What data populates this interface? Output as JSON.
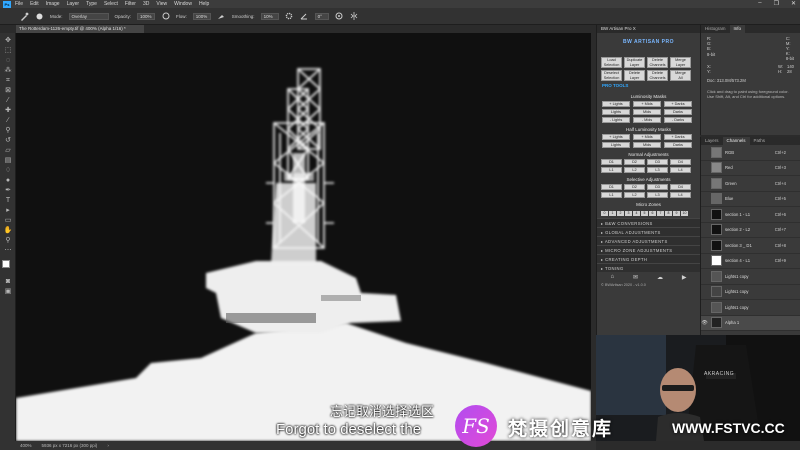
{
  "menubar": {
    "logo": "Ps",
    "items": [
      "File",
      "Edit",
      "Image",
      "Layer",
      "Type",
      "Select",
      "Filter",
      "3D",
      "View",
      "Window",
      "Help"
    ],
    "window_controls": [
      "–",
      "❐",
      "✕"
    ]
  },
  "options": {
    "mode_label": "Mode:",
    "mode_value": "Overlay",
    "opacity_label": "Opacity:",
    "opacity_value": "100%",
    "flow_label": "Flow:",
    "flow_value": "100%",
    "smoothing_label": "Smoothing:",
    "smoothing_value": "10%",
    "angle_value": "0°"
  },
  "document": {
    "tab_title": "The Rotterdam-1126-empty.tif @ 400% (Alpha 1/16) *"
  },
  "status": {
    "zoom": "400%",
    "dimensions": "5936 px x 7216 px (300 ppi)"
  },
  "plugin": {
    "title": "BW Artisan Pro X",
    "logo": "BW ARTISAN PRO",
    "top_buttons": [
      [
        "Load",
        "Selection"
      ],
      [
        "Duplicate",
        "Layer"
      ],
      [
        "Delete",
        "Channels"
      ],
      [
        "Merge",
        "Layer"
      ],
      [
        "Deselect",
        "Selection"
      ],
      [
        "Delete",
        "Layer"
      ],
      [
        "Delete",
        "Channels"
      ],
      [
        "Merge",
        "All"
      ]
    ],
    "pro_tools": "PRO TOOLS",
    "luminosity_title": "Luminosity Masks",
    "lum_row1": [
      "+ Lights",
      "+ Mids",
      "+ Darks"
    ],
    "lum_row2": [
      "Lights",
      "Mids",
      "Darks"
    ],
    "lum_row3": [
      "- Lights",
      "- Mids",
      "- Darks"
    ],
    "half_title": "Half Luminosity Masks",
    "half_row1": [
      "+ Lights",
      "+ Mids",
      "+ Darks"
    ],
    "half_row2": [
      "Lights",
      "Mids",
      "Darks"
    ],
    "normal_title": "Normal Adjustments",
    "normal_row1": [
      "D1",
      "D2",
      "D3",
      "D4"
    ],
    "normal_row2": [
      "L1",
      "L2",
      "L3",
      "L4"
    ],
    "selective_title": "Selective Adjustments",
    "selective_row1": [
      "D1",
      "D2",
      "D3",
      "D4"
    ],
    "selective_row2": [
      "L1",
      "L2",
      "L3",
      "L4"
    ],
    "micro_title": "Micro Zones",
    "zones": [
      "0",
      "1",
      "2",
      "3",
      "4",
      "5",
      "6",
      "7",
      "8",
      "9",
      "10"
    ],
    "sections": [
      "B&W CONVERSIONS",
      "GLOBAL ADJUSTMENTS",
      "ADVANCED ADJUSTMENTS",
      "MICRO ZONE ADJUSTMENTS",
      "CREATING DEPTH",
      "TONING"
    ],
    "footer": "© BWArtisan 2020 - v1.0.0"
  },
  "histo_panel": {
    "tabs": [
      "Histogram",
      "Info"
    ],
    "rgb_labels": [
      "R:",
      "G:",
      "B:"
    ],
    "cmyk_labels": [
      "C:",
      "M:",
      "Y:",
      "K:"
    ],
    "bit_left": "8-bit",
    "bit_right": "8-bit",
    "xy_labels": [
      "X:",
      "Y:"
    ],
    "wh_labels": [
      "W:",
      "H:"
    ],
    "w_value": "140",
    "h_value": "28",
    "doc": "Doc: 313.0M/573.2M",
    "hint": "Click and drag to paint using foreground color. Use Shift, Alt, and Ctrl for additional options."
  },
  "channels_panel": {
    "tabs": [
      "Layers",
      "Channels",
      "Paths"
    ],
    "rows": [
      {
        "name": "RGB",
        "shortcut": "Ctrl+2"
      },
      {
        "name": "Red",
        "shortcut": "Ctrl+3"
      },
      {
        "name": "Green",
        "shortcut": "Ctrl+4"
      },
      {
        "name": "Blue",
        "shortcut": "Ctrl+5"
      },
      {
        "name": "section 1 - L1",
        "shortcut": "Ctrl+6"
      },
      {
        "name": "section 2 - L2",
        "shortcut": "Ctrl+7"
      },
      {
        "name": "section 3 _ D1",
        "shortcut": "Ctrl+8"
      },
      {
        "name": "section 4 - L1",
        "shortcut": "Ctrl+9"
      },
      {
        "name": "Lights1 copy",
        "shortcut": ""
      },
      {
        "name": "Lights1 copy",
        "shortcut": ""
      },
      {
        "name": "Lights1 copy",
        "shortcut": ""
      },
      {
        "name": "Alpha 1",
        "shortcut": ""
      }
    ]
  },
  "webcam": {
    "chair_text": "AKRACING"
  },
  "subtitles": {
    "cn": "忘记取消选择选区",
    "en": "Forgot to deselect the"
  },
  "watermark": {
    "logo": "FS",
    "cn": "梵摄创意库",
    "url": "WWW.FSTVC.CC"
  }
}
